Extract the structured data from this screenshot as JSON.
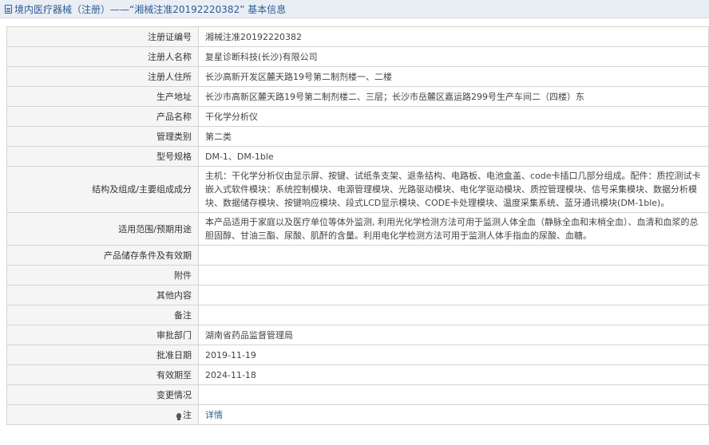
{
  "header": {
    "title": "境内医疗器械（注册）——“湘械注准20192220382” 基本信息"
  },
  "rows": [
    {
      "label": "注册证编号",
      "value": "湘械注准20192220382"
    },
    {
      "label": "注册人名称",
      "value": "复星诊断科技(长沙)有限公司"
    },
    {
      "label": "注册人住所",
      "value": "长沙高新开发区麓天路19号第二制剂楼一、二楼"
    },
    {
      "label": "生产地址",
      "value": "长沙市高新区麓天路19号第二制剂楼二、三层；长沙市岳麓区嘉运路299号生产车间二（四楼）东"
    },
    {
      "label": "产品名称",
      "value": "干化学分析仪"
    },
    {
      "label": "管理类别",
      "value": "第二类"
    },
    {
      "label": "型号规格",
      "value": "DM-1、DM-1ble"
    },
    {
      "label": "结构及组成/主要组成成分",
      "value": "主机：干化学分析仪由显示屏、按键、试纸条支架、退条结构、电路板、电池盒盖、code卡插口几部分组成。配件：质控测试卡嵌入式软件模块：系统控制模块、电源管理模块、光路驱动模块、电化学驱动模块、质控管理模块、信号采集模块、数据分析模块、数据储存模块、按键响应模块、段式LCD显示模块、CODE卡处理模块、温度采集系统、蓝牙通讯模块(DM-1ble)。"
    },
    {
      "label": "适用范围/预期用途",
      "value": "本产品适用于家庭以及医疗单位等体外监测, 利用光化学检测方法可用于监测人体全血（静脉全血和末梢全血）、血清和血浆的总胆固醇、甘油三酯、尿酸、肌酐的含量。利用电化学检测方法可用于监测人体手指血的尿酸、血糖。"
    },
    {
      "label": "产品储存条件及有效期",
      "value": ""
    },
    {
      "label": "附件",
      "value": ""
    },
    {
      "label": "其他内容",
      "value": ""
    },
    {
      "label": "备注",
      "value": ""
    },
    {
      "label": "审批部门",
      "value": "湖南省药品监督管理局"
    },
    {
      "label": "批准日期",
      "value": "2019-11-19"
    },
    {
      "label": "有效期至",
      "value": "2024-11-18"
    },
    {
      "label": "变更情况",
      "value": ""
    }
  ],
  "note": {
    "label": "注",
    "link_text": "详情"
  },
  "icons": {
    "header_icon": "document-icon",
    "note_icon": "lightbulb-icon"
  },
  "colors": {
    "header_bg": "#e9eef4",
    "header_text": "#2d5b94",
    "label_bg": "#f5f5f5",
    "border": "#d4d4d4"
  }
}
